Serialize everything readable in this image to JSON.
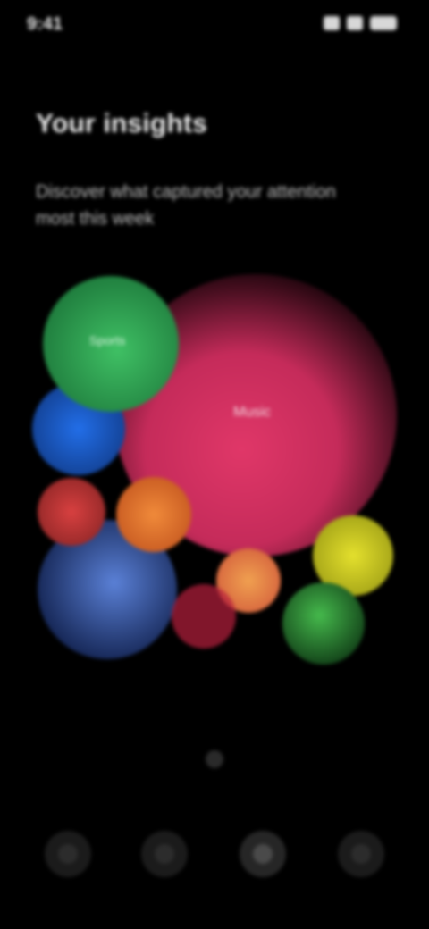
{
  "status_bar": {
    "time": "9:41"
  },
  "header": {
    "title": "Your insights",
    "subtitle": "Discover what captured your attention most this week"
  },
  "bubbles": [
    {
      "name": "large",
      "label": "Music",
      "color": "#d6325f"
    },
    {
      "name": "green",
      "label": "Sports",
      "color": "#3bb45e"
    },
    {
      "name": "blue",
      "label": "",
      "color": "#1e64d8"
    },
    {
      "name": "red",
      "label": "",
      "color": "#c8383a"
    },
    {
      "name": "orange",
      "label": "",
      "color": "#e77a33"
    },
    {
      "name": "slate",
      "label": "",
      "color": "#4a6fc6"
    },
    {
      "name": "peach",
      "label": "",
      "color": "#e8894a"
    },
    {
      "name": "yellow",
      "label": "",
      "color": "#d7d629"
    },
    {
      "name": "lime",
      "label": "",
      "color": "#3fae46"
    }
  ],
  "bottom_nav": {
    "items": [
      "home",
      "search",
      "insights",
      "profile"
    ],
    "active": "insights"
  }
}
